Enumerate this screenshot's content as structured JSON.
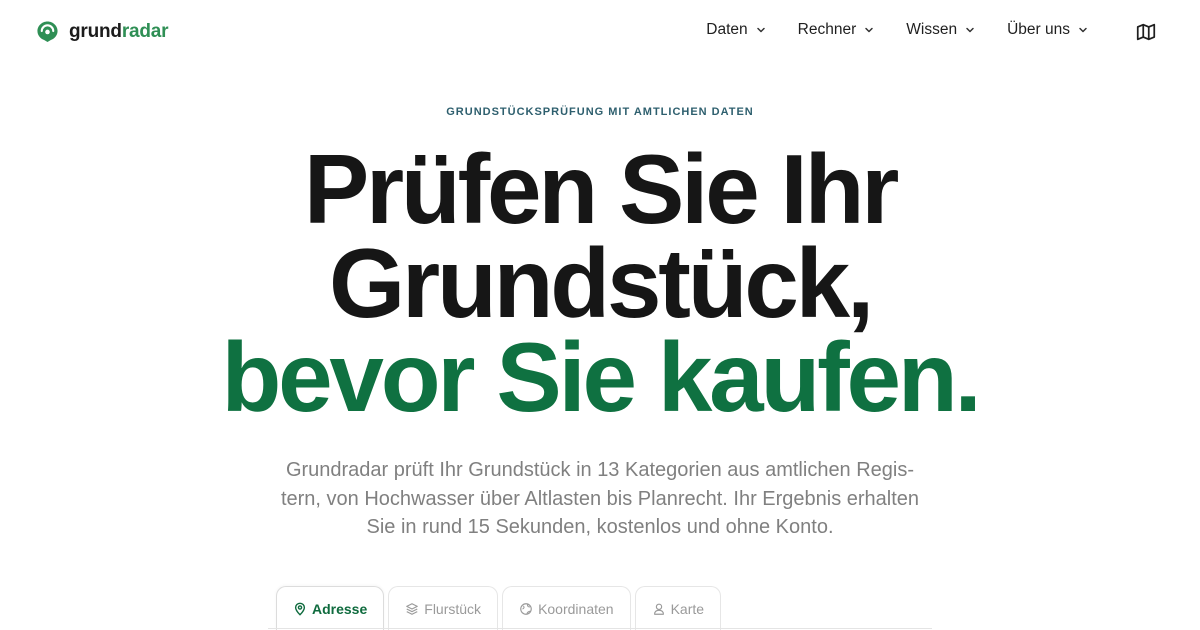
{
  "header": {
    "logo": {
      "part1": "grund",
      "part2": "radar"
    },
    "nav": [
      {
        "label": "Daten"
      },
      {
        "label": "Rechner"
      },
      {
        "label": "Wissen"
      },
      {
        "label": "Über uns"
      }
    ],
    "map_icon": "map-icon"
  },
  "hero": {
    "eyebrow": "GRUNDSTÜCKSPRÜFUNG MIT AMTLICHEN DATEN",
    "headline_line1": "Prüfen Sie Ihr",
    "headline_line2": "Grundstück,",
    "headline_line3": "bevor Sie kaufen.",
    "lead": "Grundradar prüft Ihr Grundstück in 13 Kategorien aus amtlichen Regis­tern, von Hochwasser über Altlasten bis Planrecht. Ihr Ergebnis erhal­ten Sie in rund 15 Sekunden, kostenlos und ohne Konto."
  },
  "search": {
    "tabs": [
      {
        "label": "Adresse",
        "icon": "pin-icon",
        "active": true
      },
      {
        "label": "Flurstück",
        "icon": "layers-icon",
        "active": false
      },
      {
        "label": "Koordinaten",
        "icon": "globe-icon",
        "active": false
      },
      {
        "label": "Karte",
        "icon": "map-pin-icon",
        "active": false
      }
    ]
  },
  "colors": {
    "brand_green": "#0f7141",
    "logo_green": "#2f8f55",
    "eyebrow": "#2e5f6e",
    "lead_text": "#808080"
  }
}
